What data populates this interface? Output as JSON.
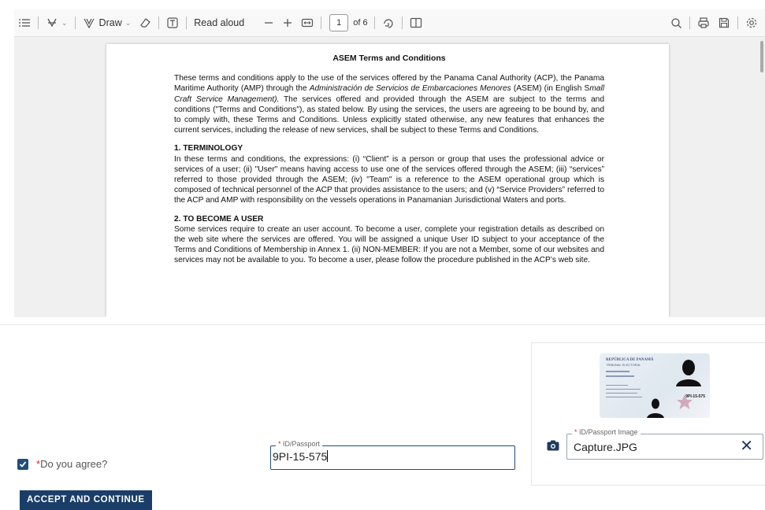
{
  "toolbar": {
    "draw_label": "Draw",
    "read_aloud_label": "Read aloud",
    "page_number": "1",
    "page_of": "of 6"
  },
  "document": {
    "title": "ASEM Terms and Conditions",
    "intro_parts": [
      "These terms and conditions apply to the use of the services offered by the Panama Canal Authority (ACP), the Panama Maritime Authority (AMP) through the ",
      "Administración de Servicios de Embarcaciones Menores",
      " (ASEM) (in English S",
      "mall Craft Service Management).",
      " The services offered and provided through the ASEM are subject to the terms and conditions (\"Terms and Conditions\"), as stated below. By using the services, the users are agreeing to be bound by, and to comply with, these Terms and Conditions. Unless explicitly stated otherwise, any new features that enhances the current services, including the release of new services, shall be subject to these Terms and Conditions."
    ],
    "section1_heading": "1. TERMINOLOGY",
    "section1_body": "In these terms and conditions, the expressions: (i) “Client” is a person or group that uses the professional advice or services of a user; (ii) \"User\" means having access to use one of the services offered through the ASEM; (iii) “services” referred to those provided through the ASEM; (iv) \"Team\" is a reference to the ASEM operational group which is composed of technical personnel of the ACP that provides assistance to the users; and (v) “Service Providers” referred to the ACP and AMP with responsibility on the vessels operations in Panamanian Jurisdictional Waters and ports.",
    "section2_heading": "2. TO BECOME A USER",
    "section2_body": "Some services require to create an user account. To become a user, complete your registration details as described on the web site where the services are offered. You will be assigned a unique User ID subject to your acceptance of the Terms and Conditions of Membership in Annex 1. (ii) NON-MEMBER: If you are not a Member, some of our websites and services may not be available to you. To become a user, please follow the procedure published in the ACP’s web site."
  },
  "id_card": {
    "line1": "REPÚBLICA DE PANAMÁ",
    "line2": "TRIBUNAL ELECTORAL",
    "number": "9PI-15-575"
  },
  "form": {
    "required_mark": "*",
    "id_field_label": "ID/Passport",
    "id_field_value": "9PI-15-575",
    "image_field_label": "ID/Passport Image",
    "image_field_value": "Capture.JPG",
    "clear_symbol": "✕",
    "agree_label": "Do you agree?",
    "agree_checked": true,
    "accept_button": "ACCEPT AND CONTINUE"
  },
  "colors": {
    "primary": "#1a3e68",
    "required": "#d32f2f"
  }
}
